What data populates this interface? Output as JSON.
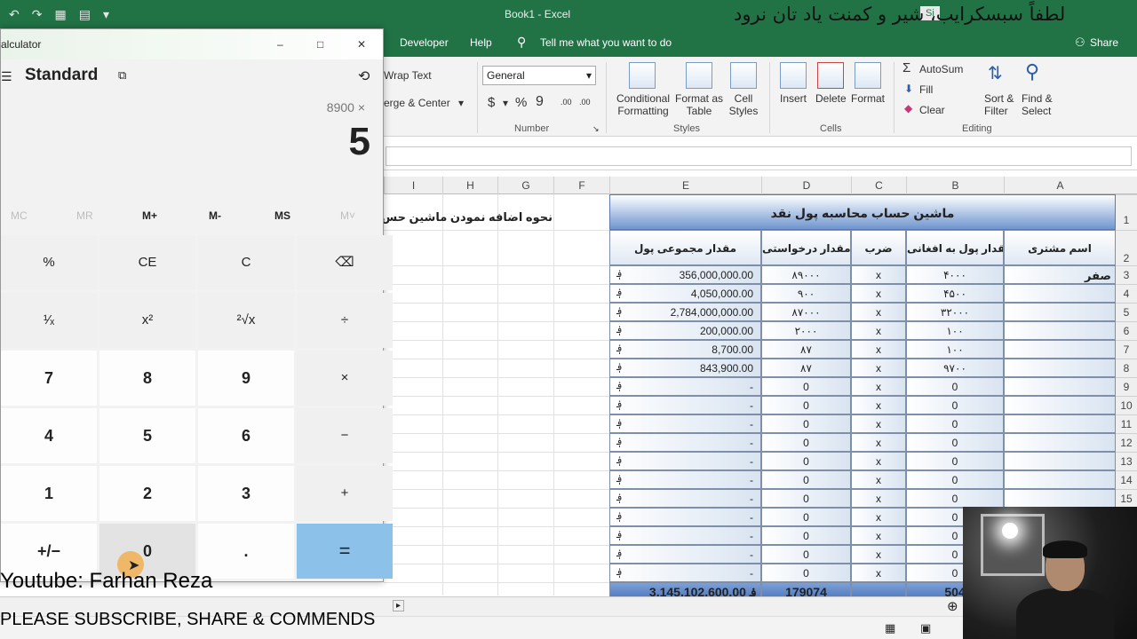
{
  "excel": {
    "book_title": "Book1  -  Excel",
    "signin": "Si",
    "overlay_text": "لطفاً سبسکرایب، شیر و کمنت یاد تان نرود",
    "menu": {
      "developer": "Developer",
      "help": "Help",
      "tell_me": "Tell me what you want to do",
      "share": "Share"
    },
    "ribbon": {
      "wrap_text": "Wrap Text",
      "merge_center": "erge & Center",
      "number_format": "General",
      "currency": "$",
      "percent": "%",
      "comma": "9",
      "increase_decimal": ".00",
      "decrease_decimal": ".00",
      "conditional_formatting": [
        "Conditional",
        "Formatting"
      ],
      "format_as_table": [
        "Format as",
        "Table"
      ],
      "cell_styles": [
        "Cell",
        "Styles"
      ],
      "insert": "Insert",
      "delete": "Delete",
      "format": "Format",
      "autosum": "AutoSum",
      "fill": "Fill",
      "clear": "Clear",
      "sort_filter": [
        "Sort &",
        "Filter"
      ],
      "find_select": [
        "Find &",
        "Select"
      ],
      "group_number": "Number",
      "group_styles": "Styles",
      "group_cells": "Cells",
      "group_editing": "Editing"
    },
    "columns": [
      "I",
      "H",
      "G",
      "F",
      "E",
      "D",
      "C",
      "B",
      "A"
    ],
    "row_numbers": [
      "1",
      "2",
      "3",
      "4",
      "5",
      "6",
      "7",
      "8",
      "9",
      "10",
      "11",
      "12",
      "13",
      "14",
      "15"
    ],
    "side_note": "نحوه اضافه نمودن ماشین حس",
    "table": {
      "banner": "ماشین حساب محاسبه پول نقد",
      "headers": {
        "total": "مقدار  مجموعی پول",
        "requested": "مقدار درخواستی",
        "multiply": "ضرب",
        "afghani": "مقدار پول به افغانی",
        "customer": "اسم مشتری"
      },
      "currency_symbol": "؋",
      "first_customer": "صفر",
      "rows": [
        {
          "total": "356,000,000.00",
          "requested": "۸۹۰۰۰",
          "x": "x",
          "afghani": "۴۰۰۰"
        },
        {
          "total": "4,050,000.00",
          "requested": "۹۰۰",
          "x": "x",
          "afghani": "۴۵۰۰"
        },
        {
          "total": "2,784,000,000.00",
          "requested": "۸۷۰۰۰",
          "x": "x",
          "afghani": "۳۲۰۰۰"
        },
        {
          "total": "200,000.00",
          "requested": "۲۰۰۰",
          "x": "x",
          "afghani": "۱۰۰"
        },
        {
          "total": "8,700.00",
          "requested": "۸۷",
          "x": "x",
          "afghani": "۱۰۰"
        },
        {
          "total": "843,900.00",
          "requested": "۸۷",
          "x": "x",
          "afghani": "۹۷۰۰"
        },
        {
          "total": "-",
          "requested": "0",
          "x": "x",
          "afghani": "0"
        },
        {
          "total": "-",
          "requested": "0",
          "x": "x",
          "afghani": "0"
        },
        {
          "total": "-",
          "requested": "0",
          "x": "x",
          "afghani": "0"
        },
        {
          "total": "-",
          "requested": "0",
          "x": "x",
          "afghani": "0"
        },
        {
          "total": "-",
          "requested": "0",
          "x": "x",
          "afghani": "0"
        },
        {
          "total": "-",
          "requested": "0",
          "x": "x",
          "afghani": "0"
        },
        {
          "total": "-",
          "requested": "0",
          "x": "x",
          "afghani": "0"
        },
        {
          "total": "-",
          "requested": "0",
          "x": "x",
          "afghani": "0"
        },
        {
          "total": "-",
          "requested": "0",
          "x": "x",
          "afghani": "0"
        },
        {
          "total": "-",
          "requested": "0",
          "x": "x",
          "afghani": "0"
        },
        {
          "total": "-",
          "requested": "0",
          "x": "x",
          "afghani": "0"
        }
      ],
      "sum_total": "3,145,102,600.00 ؋",
      "sum_requested": "179074",
      "sum_afghani": "504"
    }
  },
  "calculator": {
    "title": "alculator",
    "mode": "Standard",
    "expression": "8900 ×",
    "display": "5",
    "memory": [
      "MC",
      "MR",
      "M+",
      "M-",
      "MS",
      "M˅"
    ],
    "keys": [
      [
        "%",
        "CE",
        "C",
        "⌫"
      ],
      [
        "¹⁄ₓ",
        "x²",
        "²√x",
        "÷"
      ],
      [
        "7",
        "8",
        "9",
        "×"
      ],
      [
        "4",
        "5",
        "6",
        "−"
      ],
      [
        "1",
        "2",
        "3",
        "+"
      ],
      [
        "+/−",
        "0",
        ".",
        "="
      ]
    ]
  },
  "watermark": {
    "channel": "Youtube: Farhan Reza",
    "subscribe": "PLEASE SUBSCRIBE, SHARE & COMMENDS"
  },
  "colors": {
    "excel_green": "#217346",
    "table_header_blue": "#6f95cf",
    "equals_blue": "#8cc1ea"
  }
}
